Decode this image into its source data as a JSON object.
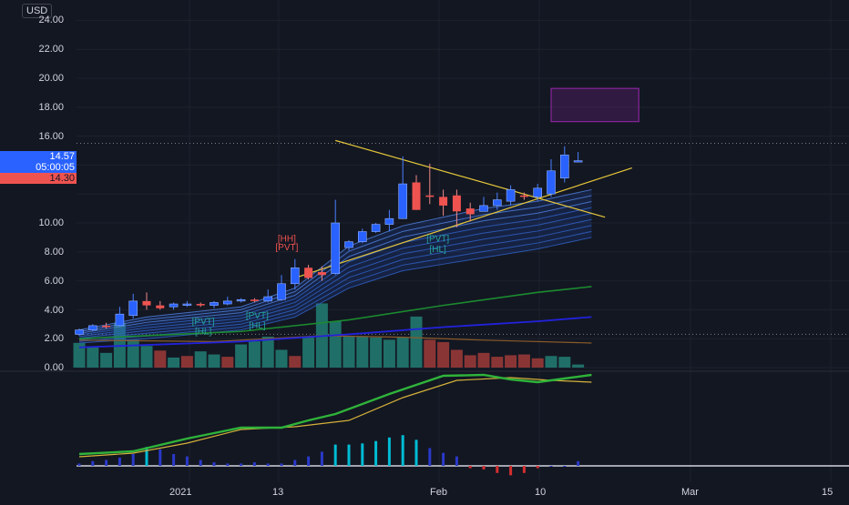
{
  "header": {
    "currency": "USD"
  },
  "y_axis": {
    "labels": [
      "24.00",
      "22.00",
      "20.00",
      "18.00",
      "16.00",
      "10.00",
      "8.00",
      "6.00",
      "4.00",
      "2.00",
      "0.00"
    ]
  },
  "x_axis": {
    "labels": [
      "2021",
      "13",
      "Feb",
      "10",
      "Mar",
      "15"
    ]
  },
  "price_tags": {
    "last_price": "14.57",
    "countdown": "05:00:05",
    "prev_price": "14.30"
  },
  "annotations": {
    "hh": "[HH]",
    "pvt_high": "[PVT]",
    "pvt_low_1": "[PVT]",
    "hl_1": "[HL]",
    "pvt_low_2": "[PVT]",
    "hl_2": "[HL]",
    "pvt_low_3": "[PVT]",
    "hl_3": "[HL]"
  },
  "colors": {
    "background": "#131722",
    "up_candle": "#2962ff",
    "down_candle": "#ef5350",
    "volume_up": "#26a69a",
    "volume_down": "#ef5350",
    "ema_fast": "#2a6fcf",
    "ma_green": "#1b8a2f",
    "ma_blue": "#2222dd",
    "trendline": "#e5c73a",
    "box": "#9c27b0"
  },
  "chart_data": {
    "type": "candlestick",
    "ylim": [
      0,
      25
    ],
    "candles": [
      {
        "o": 2.3,
        "h": 2.7,
        "l": 2.2,
        "c": 2.6
      },
      {
        "o": 2.6,
        "h": 3.0,
        "l": 2.5,
        "c": 2.9
      },
      {
        "o": 2.9,
        "h": 3.1,
        "l": 2.7,
        "c": 2.8
      },
      {
        "o": 2.9,
        "h": 4.2,
        "l": 2.8,
        "c": 3.7
      },
      {
        "o": 3.6,
        "h": 5.1,
        "l": 3.4,
        "c": 4.6
      },
      {
        "o": 4.6,
        "h": 5.2,
        "l": 4.0,
        "c": 4.3
      },
      {
        "o": 4.3,
        "h": 4.6,
        "l": 4.0,
        "c": 4.1
      },
      {
        "o": 4.2,
        "h": 4.5,
        "l": 4.0,
        "c": 4.4
      },
      {
        "o": 4.3,
        "h": 4.6,
        "l": 4.2,
        "c": 4.4
      },
      {
        "o": 4.4,
        "h": 4.5,
        "l": 4.2,
        "c": 4.3
      },
      {
        "o": 4.3,
        "h": 4.6,
        "l": 4.1,
        "c": 4.5
      },
      {
        "o": 4.4,
        "h": 4.9,
        "l": 4.3,
        "c": 4.6
      },
      {
        "o": 4.6,
        "h": 4.8,
        "l": 4.5,
        "c": 4.7
      },
      {
        "o": 4.7,
        "h": 4.8,
        "l": 4.5,
        "c": 4.6
      },
      {
        "o": 4.6,
        "h": 5.4,
        "l": 4.5,
        "c": 4.9
      },
      {
        "o": 4.7,
        "h": 6.4,
        "l": 4.6,
        "c": 5.8
      },
      {
        "o": 5.8,
        "h": 7.5,
        "l": 5.4,
        "c": 6.9
      },
      {
        "o": 6.9,
        "h": 7.1,
        "l": 6.1,
        "c": 6.2
      },
      {
        "o": 6.6,
        "h": 7.0,
        "l": 6.0,
        "c": 6.4
      },
      {
        "o": 6.5,
        "h": 11.6,
        "l": 6.4,
        "c": 10.0
      },
      {
        "o": 8.3,
        "h": 8.8,
        "l": 8.1,
        "c": 8.7
      },
      {
        "o": 8.7,
        "h": 9.6,
        "l": 8.6,
        "c": 9.4
      },
      {
        "o": 9.4,
        "h": 10.0,
        "l": 9.3,
        "c": 9.9
      },
      {
        "o": 9.9,
        "h": 10.9,
        "l": 9.4,
        "c": 10.3
      },
      {
        "o": 10.3,
        "h": 14.6,
        "l": 10.3,
        "c": 12.7
      },
      {
        "o": 12.8,
        "h": 13.3,
        "l": 10.9,
        "c": 10.9
      },
      {
        "o": 11.9,
        "h": 14.1,
        "l": 11.3,
        "c": 11.8
      },
      {
        "o": 11.8,
        "h": 12.3,
        "l": 10.5,
        "c": 11.2
      },
      {
        "o": 11.9,
        "h": 12.3,
        "l": 9.7,
        "c": 10.8
      },
      {
        "o": 11.0,
        "h": 11.4,
        "l": 10.1,
        "c": 10.6
      },
      {
        "o": 10.8,
        "h": 11.8,
        "l": 10.8,
        "c": 11.2
      },
      {
        "o": 11.2,
        "h": 12.1,
        "l": 10.9,
        "c": 11.6
      },
      {
        "o": 11.5,
        "h": 12.6,
        "l": 11.2,
        "c": 12.3
      },
      {
        "o": 11.9,
        "h": 12.1,
        "l": 11.6,
        "c": 11.8
      },
      {
        "o": 11.8,
        "h": 12.7,
        "l": 11.5,
        "c": 12.4
      },
      {
        "o": 12.0,
        "h": 14.4,
        "l": 11.8,
        "c": 13.6
      },
      {
        "o": 13.1,
        "h": 15.3,
        "l": 12.8,
        "c": 14.7
      },
      {
        "o": 14.3,
        "h": 14.9,
        "l": 14.3,
        "c": 14.3
      }
    ],
    "volume": [
      {
        "v": 3.2,
        "up": true
      },
      {
        "v": 2.6,
        "up": true
      },
      {
        "v": 1.9,
        "up": true
      },
      {
        "v": 5.8,
        "up": true
      },
      {
        "v": 3.6,
        "up": true
      },
      {
        "v": 2.8,
        "up": true
      },
      {
        "v": 2.2,
        "up": false
      },
      {
        "v": 1.3,
        "up": true
      },
      {
        "v": 1.5,
        "up": false
      },
      {
        "v": 2.1,
        "up": true
      },
      {
        "v": 1.7,
        "up": true
      },
      {
        "v": 1.4,
        "up": false
      },
      {
        "v": 3.0,
        "up": true
      },
      {
        "v": 3.4,
        "up": true
      },
      {
        "v": 4.0,
        "up": true
      },
      {
        "v": 2.3,
        "up": true
      },
      {
        "v": 1.5,
        "up": false
      },
      {
        "v": 3.9,
        "up": true
      },
      {
        "v": 8.3,
        "up": true
      },
      {
        "v": 6.0,
        "up": true
      },
      {
        "v": 4.1,
        "up": true
      },
      {
        "v": 4.0,
        "up": true
      },
      {
        "v": 3.9,
        "up": true
      },
      {
        "v": 3.6,
        "up": true
      },
      {
        "v": 3.9,
        "up": true
      },
      {
        "v": 6.6,
        "up": true
      },
      {
        "v": 3.6,
        "up": false
      },
      {
        "v": 3.3,
        "up": false
      },
      {
        "v": 2.3,
        "up": false
      },
      {
        "v": 1.6,
        "up": false
      },
      {
        "v": 1.9,
        "up": false
      },
      {
        "v": 1.4,
        "up": false
      },
      {
        "v": 1.6,
        "up": false
      },
      {
        "v": 1.7,
        "up": false
      },
      {
        "v": 1.2,
        "up": false
      },
      {
        "v": 1.5,
        "up": true
      },
      {
        "v": 1.4,
        "up": true
      },
      {
        "v": 0.4,
        "up": true
      }
    ],
    "ma_green": [
      [
        0,
        2.0
      ],
      [
        12,
        2.5
      ],
      [
        20,
        3.3
      ],
      [
        27,
        4.3
      ],
      [
        34,
        5.2
      ],
      [
        38,
        5.6
      ]
    ],
    "ma_blue": [
      [
        0,
        1.4
      ],
      [
        12,
        1.8
      ],
      [
        20,
        2.3
      ],
      [
        27,
        2.8
      ],
      [
        34,
        3.2
      ],
      [
        38,
        3.5
      ]
    ],
    "ma_orange": [
      [
        0,
        1.9
      ],
      [
        10,
        1.8
      ],
      [
        18,
        2.2
      ],
      [
        24,
        2.1
      ],
      [
        30,
        1.9
      ],
      [
        38,
        1.7
      ]
    ],
    "ribbon_top": [
      [
        0,
        2.6
      ],
      [
        5,
        3.5
      ],
      [
        12,
        4.2
      ],
      [
        16,
        5.5
      ],
      [
        20,
        8.4
      ],
      [
        24,
        9.8
      ],
      [
        30,
        11.0
      ],
      [
        34,
        11.5
      ],
      [
        38,
        12.3
      ]
    ],
    "ribbon_bottom": [
      [
        0,
        1.7
      ],
      [
        5,
        2.0
      ],
      [
        12,
        2.6
      ],
      [
        16,
        3.5
      ],
      [
        20,
        5.5
      ],
      [
        24,
        6.7
      ],
      [
        30,
        7.6
      ],
      [
        34,
        8.2
      ],
      [
        38,
        9.0
      ]
    ],
    "trendline_desc": [
      [
        19,
        15.7
      ],
      [
        39,
        10.4
      ]
    ],
    "trendline_asc": [
      [
        16,
        6.2
      ],
      [
        41,
        13.8
      ]
    ],
    "target_box": {
      "x_start": 35,
      "x_end": 41.5,
      "y_low": 17.0,
      "y_high": 19.3
    },
    "dotted_lines": [
      15.5,
      2.3
    ],
    "oscillator": {
      "fast": [
        [
          0,
          0.13
        ],
        [
          4,
          0.16
        ],
        [
          8,
          0.3
        ],
        [
          12,
          0.42
        ],
        [
          15,
          0.42
        ],
        [
          17,
          0.5
        ],
        [
          19,
          0.57
        ],
        [
          23,
          0.79
        ],
        [
          27,
          0.99
        ],
        [
          30,
          1.0
        ],
        [
          32,
          0.95
        ],
        [
          34,
          0.92
        ],
        [
          36,
          0.96
        ],
        [
          38,
          1.0
        ]
      ],
      "slow": [
        [
          0,
          0.1
        ],
        [
          4,
          0.14
        ],
        [
          8,
          0.25
        ],
        [
          12,
          0.4
        ],
        [
          16,
          0.43
        ],
        [
          20,
          0.5
        ],
        [
          24,
          0.75
        ],
        [
          28,
          0.94
        ],
        [
          32,
          0.97
        ],
        [
          35,
          0.94
        ],
        [
          38,
          0.92
        ]
      ],
      "histogram": [
        0.02,
        0.04,
        0.05,
        0.07,
        0.1,
        0.16,
        0.14,
        0.1,
        0.08,
        0.05,
        0.03,
        0.02,
        0.02,
        0.03,
        0.02,
        0.02,
        0.05,
        0.08,
        0.12,
        0.18,
        0.18,
        0.19,
        0.21,
        0.24,
        0.26,
        0.22,
        0.15,
        0.11,
        0.08,
        -0.02,
        -0.03,
        -0.06,
        -0.08,
        -0.06,
        -0.02,
        0.0,
        0.0,
        0.04
      ]
    }
  }
}
